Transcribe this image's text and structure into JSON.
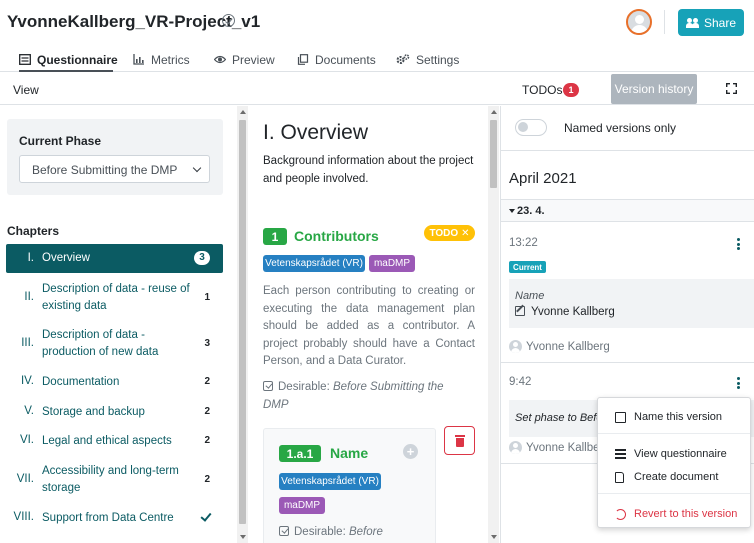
{
  "header": {
    "project_title": "YvonneKallberg_VR-Project_v1",
    "share_label": "Share"
  },
  "tabs": [
    {
      "label": "Questionnaire",
      "active": true,
      "icon": "questionnaire-icon"
    },
    {
      "label": "Metrics",
      "icon": "chart-icon"
    },
    {
      "label": "Preview",
      "icon": "eye-icon"
    },
    {
      "label": "Documents",
      "icon": "copy-icon"
    },
    {
      "label": "Settings",
      "icon": "gears-icon"
    }
  ],
  "toolbar": {
    "view_label": "View",
    "todos_label": "TODOs",
    "todos_count": "1",
    "version_history_label": "Version history"
  },
  "sidebar": {
    "phase_title": "Current Phase",
    "phase_value": "Before Submitting the DMP",
    "chapters_title": "Chapters",
    "chapters": [
      {
        "num": "I.",
        "label": "Overview",
        "count": "3",
        "active": true
      },
      {
        "num": "II.",
        "label": "Description of data - reuse of existing data",
        "count": "1"
      },
      {
        "num": "III.",
        "label": "Description of data - production of new data",
        "count": "3"
      },
      {
        "num": "IV.",
        "label": "Documentation",
        "count": "2"
      },
      {
        "num": "V.",
        "label": "Storage and backup",
        "count": "2"
      },
      {
        "num": "VI.",
        "label": "Legal and ethical aspects",
        "count": "2"
      },
      {
        "num": "VII.",
        "label": "Accessibility and long-term storage",
        "count": "2"
      },
      {
        "num": "VIII.",
        "label": "Support from Data Centre",
        "count": ""
      }
    ]
  },
  "content": {
    "chapter_title": "I. Overview",
    "chapter_desc": "Background information about the project and people involved.",
    "question": {
      "number": "1",
      "title": "Contributors",
      "todo_label": "TODO",
      "tags": [
        "Vetenskapsrådet (VR)",
        "maDMP"
      ],
      "description": "Each person contributing to creating or executing the data management plan should be added as a contributor. A project probably should have a Contact Person, and a Data Curator.",
      "desirable_prefix": "Desirable:",
      "desirable_phase": "Before Submitting the DMP"
    },
    "subquestion": {
      "number": "1.a.1",
      "title": "Name",
      "tags": [
        "Vetenskapsrådet (VR)",
        "maDMP"
      ],
      "desirable_prefix": "Desirable:",
      "desirable_phase": "Before"
    }
  },
  "version_history": {
    "toggle_label": "Named versions only",
    "month": "April 2021",
    "day": "23. 4.",
    "versions": [
      {
        "time": "13:22",
        "badge": "Current",
        "name_label": "Name",
        "name_value": "Yvonne Kallberg",
        "author": "Yvonne Kallberg"
      },
      {
        "time": "9:42",
        "event": "Set phase to Befo",
        "author": "Yvonne Kallber"
      }
    ]
  },
  "context_menu": {
    "items": [
      {
        "label": "Name this version",
        "icon": "edit-icon"
      },
      {
        "label": "View questionnaire",
        "icon": "list-icon"
      },
      {
        "label": "Create document",
        "icon": "file-icon"
      },
      {
        "label": "Revert to this version",
        "icon": "history-icon",
        "danger": true
      }
    ]
  },
  "colors": {
    "primary": "#0b5b63",
    "share": "#17a2b8",
    "success": "#28a745",
    "warning": "#ffc107",
    "danger": "#dc3545",
    "tag_blue": "#2680c2",
    "tag_purple": "#9b59b6"
  }
}
